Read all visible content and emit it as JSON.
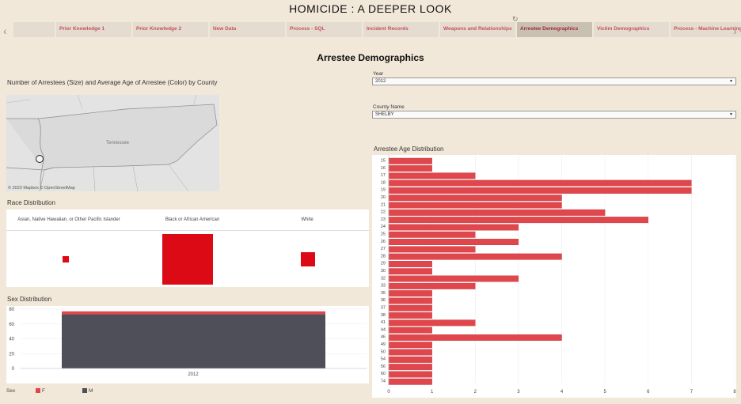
{
  "page": {
    "title": "HOMICIDE : A DEEPER LOOK",
    "heading": "Arrestee Demographics"
  },
  "nav": {
    "prev_icon": "‹",
    "next_icon": "›",
    "refresh_icon": "↻"
  },
  "tabs": [
    {
      "label": ""
    },
    {
      "label": "Prior Knowledge 1"
    },
    {
      "label": "Prior Knowledge 2"
    },
    {
      "label": "New Data"
    },
    {
      "label": "Process - SQL"
    },
    {
      "label": "Incident Records"
    },
    {
      "label": "Weapons and Relationships"
    },
    {
      "label": "Arrestee Demographics"
    },
    {
      "label": "Victim Demographics"
    },
    {
      "label": "Process - Machine Learning"
    }
  ],
  "map": {
    "title": "Number of Arrestees (Size) and Average Age of Arrestee (Color) by County",
    "state_label": "Tennessee",
    "credit": "© 2023 Mapbox  © OpenStreetMap"
  },
  "filters": {
    "year_label": "Year",
    "year_value": "2012",
    "county_label": "County Name",
    "county_value": "SHELBY",
    "caret": "▼"
  },
  "race": {
    "title": "Race Distribution",
    "categories": [
      "Asian, Native Hawaiian, or Other Pacific Islander",
      "Black or African American",
      "White"
    ],
    "values": [
      1,
      73,
      6
    ]
  },
  "sex": {
    "title": "Sex Distribution",
    "legend_title": "Sex",
    "legend": [
      {
        "label": "F",
        "color": "#e0474c"
      },
      {
        "label": "M",
        "color": "#4e4f58"
      }
    ]
  },
  "age": {
    "title": "Arrestee Age Distribution"
  },
  "colors": {
    "accent": "#dc0a14",
    "bar": "#e0474c",
    "dark": "#4e4f58"
  },
  "chart_data": [
    {
      "type": "bar",
      "orientation": "horizontal",
      "categories": [
        "15",
        "16",
        "17",
        "18",
        "19",
        "20",
        "21",
        "22",
        "23",
        "24",
        "25",
        "26",
        "27",
        "28",
        "29",
        "30",
        "32",
        "33",
        "35",
        "36",
        "37",
        "38",
        "41",
        "44",
        "46",
        "49",
        "50",
        "54",
        "56",
        "60",
        "74"
      ],
      "values": [
        1,
        1,
        2,
        7,
        7,
        4,
        4,
        5,
        6,
        3,
        2,
        3,
        2,
        4,
        1,
        1,
        3,
        2,
        1,
        1,
        1,
        1,
        2,
        1,
        4,
        1,
        1,
        1,
        1,
        1,
        1
      ],
      "xlim": [
        0,
        8
      ],
      "xticks": [
        "0",
        "1",
        "2",
        "3",
        "4",
        "5",
        "6",
        "7",
        "8"
      ],
      "grid": true
    },
    {
      "type": "bar",
      "stacked": true,
      "categories": [
        "2012"
      ],
      "series": [
        {
          "name": "F",
          "values": [
            4
          ]
        },
        {
          "name": "M",
          "values": [
            73
          ]
        }
      ],
      "ylim": [
        0,
        80
      ],
      "yticks": [
        "0",
        "20",
        "40",
        "60",
        "80"
      ],
      "grid": true
    }
  ]
}
